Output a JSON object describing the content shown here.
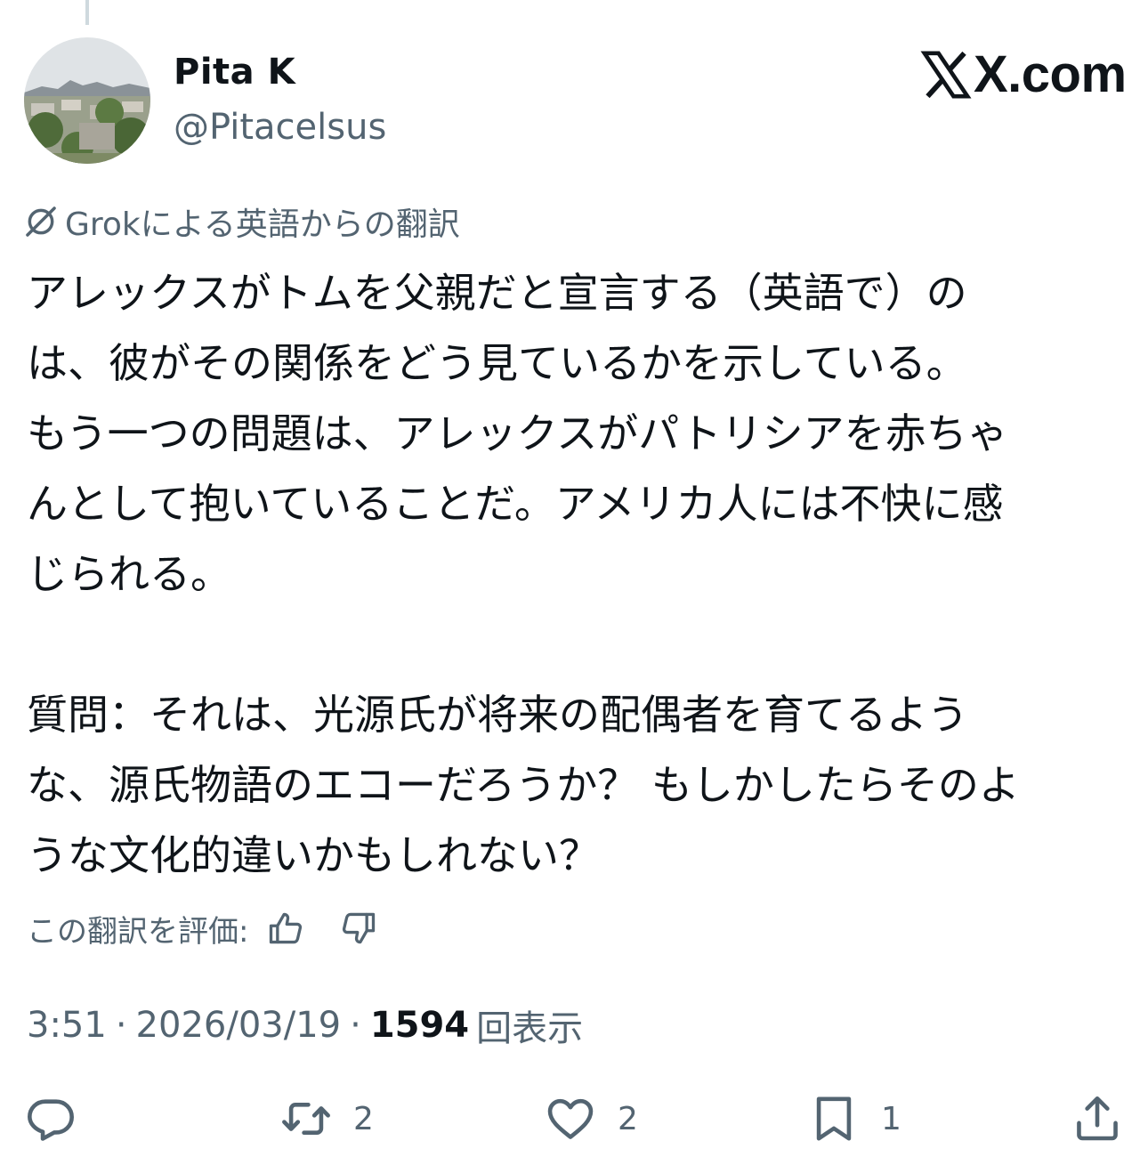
{
  "tweet": {
    "author_name": "Pita K",
    "author_handle": "@Pitacelsus",
    "brand": "X.com",
    "translation_label": "Grokによる英語からの翻訳",
    "paragraphs": [
      "アレックスがトムを父親だと宣言する（英語で）の\nは、彼がその関係をどう見ているかを示している。\nもう一つの問題は、アレックスがパトリシアを赤ちゃ\nんとして抱いていることだ。アメリカ人には不快に感\nじられる。",
      "質問：それは、光源氏が将来の配偶者を育てるよう\nな、源氏物語のエコーだろうか？ もしかしたらそのよ\nうな文化的違いかもしれない？"
    ],
    "rate_translation_label": "この翻訳を評価:",
    "time": "3:51",
    "date": "2026/03/19",
    "separator": "·",
    "views_count": "1594",
    "views_label": "回表示"
  },
  "actions": {
    "reply": {
      "icon": "reply-icon",
      "count": ""
    },
    "repost": {
      "icon": "repost-icon",
      "count": "2"
    },
    "like": {
      "icon": "heart-icon",
      "count": "2"
    },
    "bookmark": {
      "icon": "bookmark-icon",
      "count": "1"
    },
    "share": {
      "icon": "share-icon",
      "count": ""
    }
  },
  "colors": {
    "text_primary": "#0f1419",
    "text_secondary": "#536471",
    "background": "#ffffff",
    "thread_line": "#cfd9de"
  }
}
